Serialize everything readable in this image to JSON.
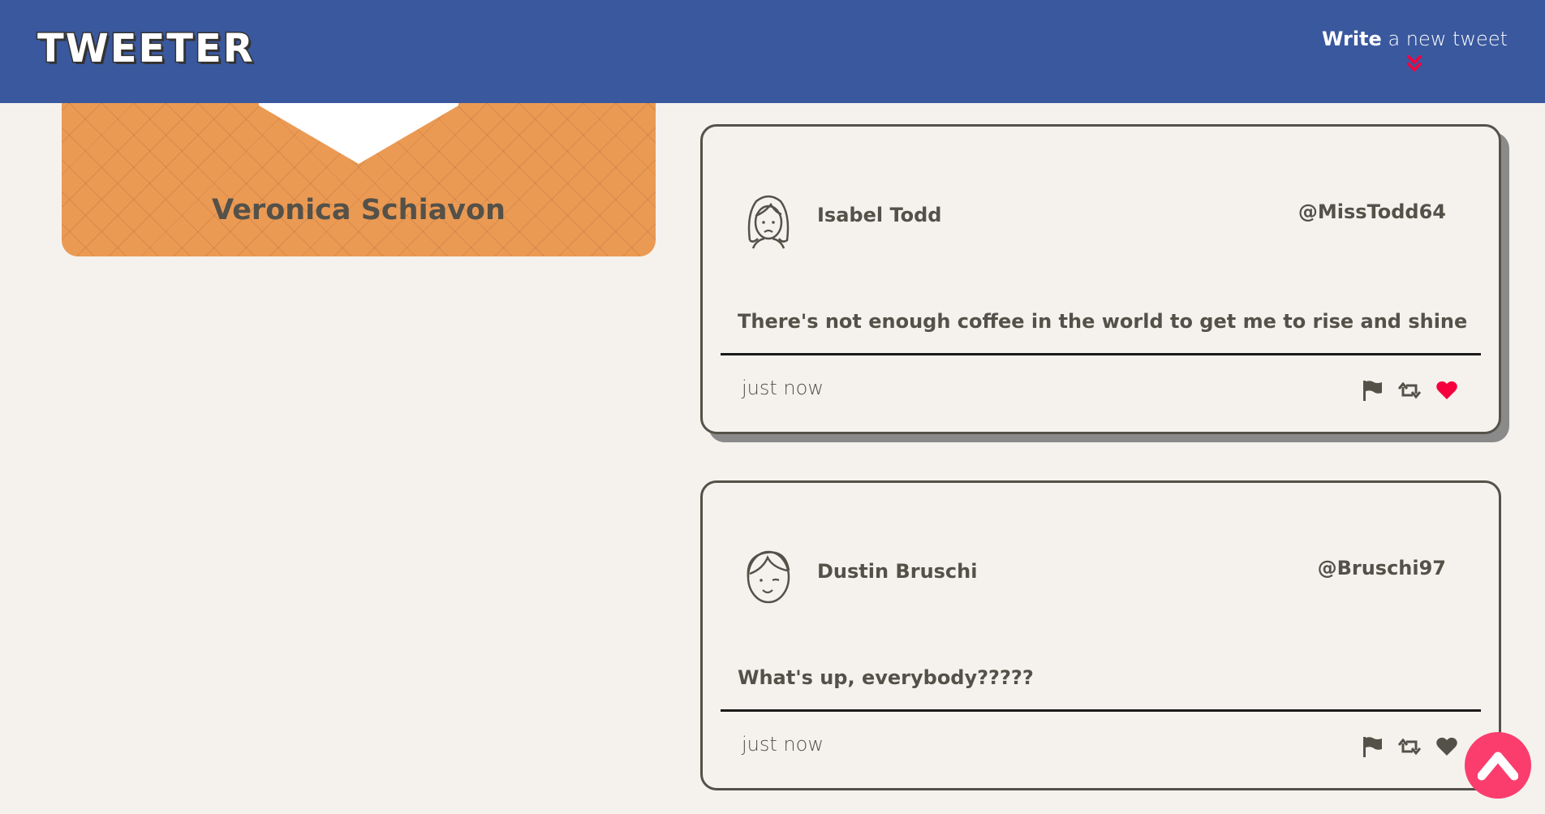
{
  "nav": {
    "brand": "TWEETER",
    "compose_bold": "Write",
    "compose_rest": " a new tweet"
  },
  "profile": {
    "name": "Veronica Schiavon"
  },
  "tweets": [
    {
      "name": "Isabel Todd",
      "handle": "@MissTodd64",
      "text": "There's not enough coffee in the world to get me to rise and shine",
      "time": "just now",
      "liked": true
    },
    {
      "name": "Dustin Bruschi",
      "handle": "@Bruschi97",
      "text": "What's up, everybody?????",
      "time": "just now",
      "liked": false
    }
  ],
  "colors": {
    "nav_bg": "#3a589e",
    "page_bg": "#f5f2ed",
    "profile_bg": "#eb9a54",
    "text": "#545149",
    "accent": "#fb3d6e",
    "like_active": "#f5003d"
  },
  "icons": {
    "compose": "chevrons-down-icon",
    "flag": "flag-icon",
    "retweet": "retweet-icon",
    "like": "heart-icon",
    "scroll_top": "chevron-up-icon"
  }
}
